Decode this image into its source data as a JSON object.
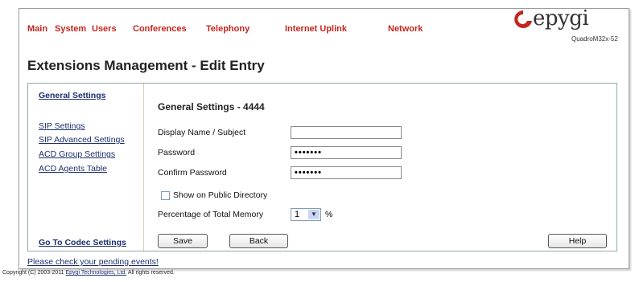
{
  "nav": {
    "items": [
      "Main",
      "System",
      "Users",
      "Conferences",
      "Telephony",
      "Internet Uplink",
      "Network"
    ]
  },
  "logo": {
    "brand": "epygi",
    "model": "QuadroM32x-52"
  },
  "page_title": "Extensions Management - Edit Entry",
  "sidebar": {
    "general": "General Settings",
    "sip": "SIP Settings",
    "sip_advanced": "SIP Advanced Settings",
    "acd_group": "ACD Group Settings",
    "acd_agents": "ACD Agents Table",
    "codec": "Go To Codec Settings"
  },
  "form": {
    "title": "General Settings - 4444",
    "display_name_label": "Display Name / Subject",
    "display_name_value": "",
    "password_label": "Password",
    "password_value": "•••••••",
    "confirm_label": "Confirm Password",
    "confirm_value": "•••••••",
    "public_dir_label": "Show on Public Directory",
    "public_dir_checked": false,
    "memory_label": "Percentage of Total Memory",
    "memory_value": "1",
    "memory_unit": "%"
  },
  "buttons": {
    "save": "Save",
    "back": "Back",
    "help": "Help"
  },
  "footer": {
    "pending": "Please check your pending events!",
    "copyright_prefix": "Copyright (C) 2003-2011",
    "company": "Epygi Technologies, Ltd.",
    "rights": "All rights reserved."
  },
  "colors": {
    "nav": "#c4261d",
    "link": "#1c2f6d",
    "logo_mark": "#c4261d"
  },
  "icons": {
    "logo": "epygi-swirl-icon",
    "dropdown": "chevron-down-icon"
  }
}
